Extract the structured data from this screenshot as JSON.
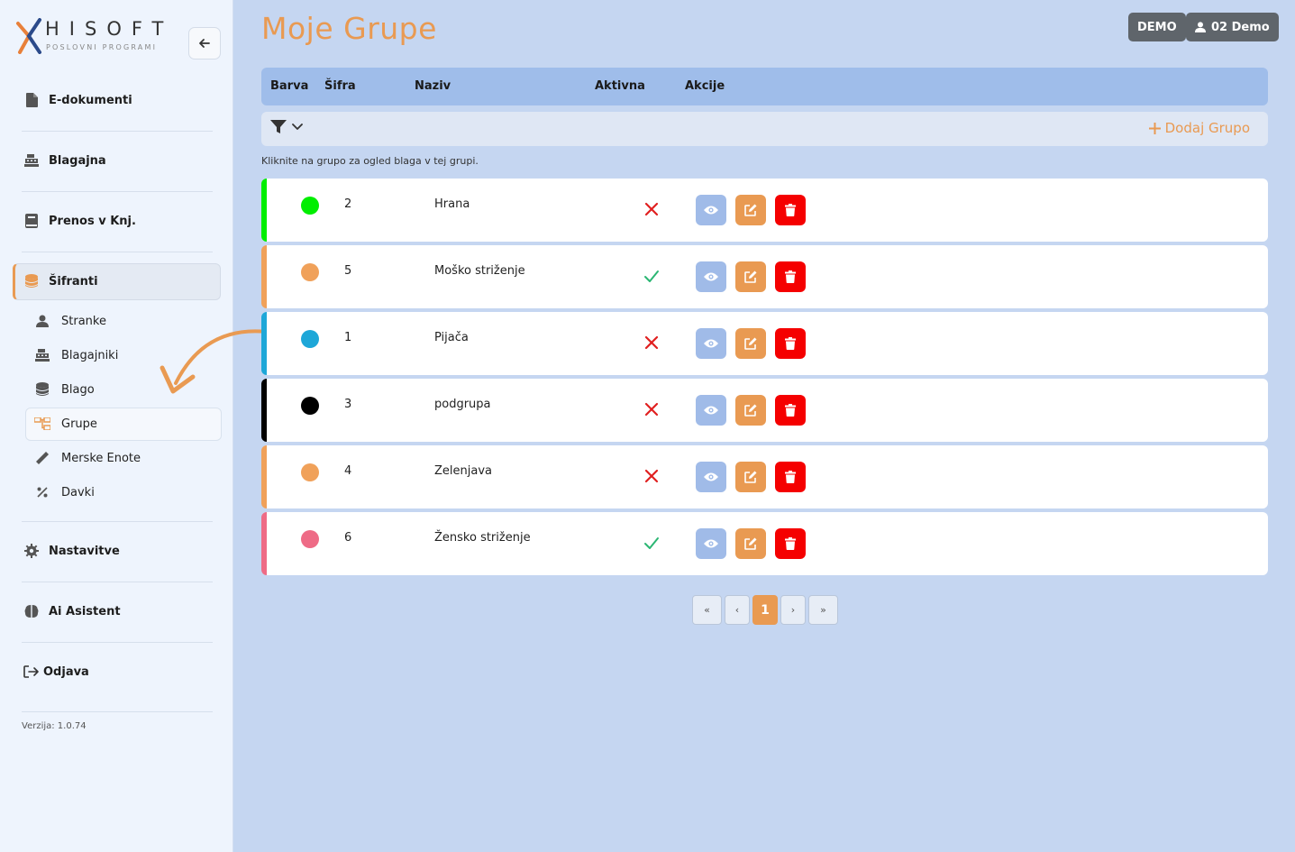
{
  "brand": {
    "name": "HISOFT",
    "tagline": "POSLOVNI PROGRAMI"
  },
  "sidebar": {
    "main_items": [
      {
        "label": "E-dokumenti",
        "icon": "file-icon"
      },
      {
        "label": "Blagajna",
        "icon": "cash-register-icon"
      },
      {
        "label": "Prenos v Knj.",
        "icon": "book-icon"
      },
      {
        "label": "Šifranti",
        "icon": "database-icon"
      }
    ],
    "sub_items": [
      {
        "label": "Stranke",
        "icon": "user-icon"
      },
      {
        "label": "Blagajniki",
        "icon": "cash-register-icon"
      },
      {
        "label": "Blago",
        "icon": "database-icon"
      },
      {
        "label": "Grupe",
        "icon": "sitemap-icon"
      },
      {
        "label": "Merske Enote",
        "icon": "ruler-icon"
      },
      {
        "label": "Davki",
        "icon": "percent-icon"
      }
    ],
    "bottom_items": [
      {
        "label": "Nastavitve",
        "icon": "gear-icon"
      },
      {
        "label": "Ai Asistent",
        "icon": "brain-icon"
      },
      {
        "label": "Odjava",
        "icon": "logout-icon"
      }
    ],
    "version": "Verzija: 1.0.74"
  },
  "header": {
    "title": "Moje Grupe",
    "demo_badge": "DEMO",
    "user_badge": "02 Demo"
  },
  "table": {
    "columns": [
      "Barva",
      "Šifra",
      "Naziv",
      "Aktivna",
      "Akcije"
    ],
    "add_label": "Dodaj Grupo",
    "hint": "Kliknite na grupo za ogled blaga v tej grupi.",
    "rows": [
      {
        "color": "#00ee00",
        "code": "2",
        "name": "Hrana",
        "active": false
      },
      {
        "color": "#f0a15a",
        "code": "5",
        "name": "Moško striženje",
        "active": true
      },
      {
        "color": "#1ea7d8",
        "code": "1",
        "name": "Pijača",
        "active": false
      },
      {
        "color": "#000000",
        "code": "3",
        "name": "podgrupa",
        "active": false
      },
      {
        "color": "#f0a15a",
        "code": "4",
        "name": "Zelenjava",
        "active": false
      },
      {
        "color": "#ee6b86",
        "code": "6",
        "name": "Žensko striženje",
        "active": true
      }
    ]
  },
  "pagination": {
    "first": "«",
    "prev": "‹",
    "current": "1",
    "next": "›",
    "last": "»"
  },
  "colors": {
    "accent": "#e99a52",
    "header_bg": "#9fbdea",
    "delete": "#f50000",
    "view": "#a0bbe8",
    "active_check": "#2bb673",
    "inactive_x": "#e02020"
  }
}
